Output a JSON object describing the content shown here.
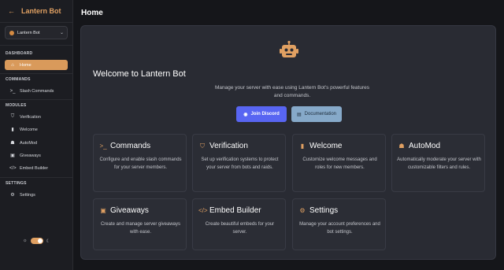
{
  "brand": {
    "title": "Lantern Bot",
    "back_icon": "arrow-left-icon"
  },
  "server": {
    "name": "Lantern Bot"
  },
  "sidebar": {
    "sections": [
      {
        "label": "DASHBOARD"
      },
      {
        "label": "COMMANDS"
      },
      {
        "label": "MODULES"
      },
      {
        "label": "SETTINGS"
      }
    ],
    "items": [
      {
        "label": "Home",
        "icon": "home-icon"
      },
      {
        "label": "Slash Commands",
        "icon": "terminal-icon"
      },
      {
        "label": "Verification",
        "icon": "shield-icon"
      },
      {
        "label": "Welcome",
        "icon": "door-icon"
      },
      {
        "label": "AutoMod",
        "icon": "robot-icon"
      },
      {
        "label": "Giveaways",
        "icon": "gift-icon"
      },
      {
        "label": "Embed Builder",
        "icon": "code-icon"
      },
      {
        "label": "Settings",
        "icon": "gear-icon"
      }
    ]
  },
  "header": {
    "title": "Home"
  },
  "main": {
    "title": "Welcome to Lantern Bot",
    "subtitle": "Manage your server with ease using Lantern Bot's powerful features and commands.",
    "buttons": {
      "discord": "Join Discord",
      "docs": "Documentation"
    },
    "features": [
      {
        "title": "Commands",
        "desc": "Configure and enable slash commands for your server members.",
        "icon": "terminal-icon"
      },
      {
        "title": "Verification",
        "desc": "Set up verification systems to protect your server from bots and raids.",
        "icon": "shield-icon"
      },
      {
        "title": "Welcome",
        "desc": "Customize welcome messages and roles for new members.",
        "icon": "door-icon"
      },
      {
        "title": "AutoMod",
        "desc": "Automatically moderate your server with customizable filters and rules.",
        "icon": "robot-icon"
      },
      {
        "title": "Giveaways",
        "desc": "Create and manage server giveaways with ease.",
        "icon": "gift-icon"
      },
      {
        "title": "Embed Builder",
        "desc": "Create beautiful embeds for your server.",
        "icon": "code-icon"
      },
      {
        "title": "Settings",
        "desc": "Manage your account preferences and bot settings.",
        "icon": "gear-icon"
      }
    ]
  },
  "theme": {
    "mode": "dark",
    "accent": "#d99a5b"
  }
}
